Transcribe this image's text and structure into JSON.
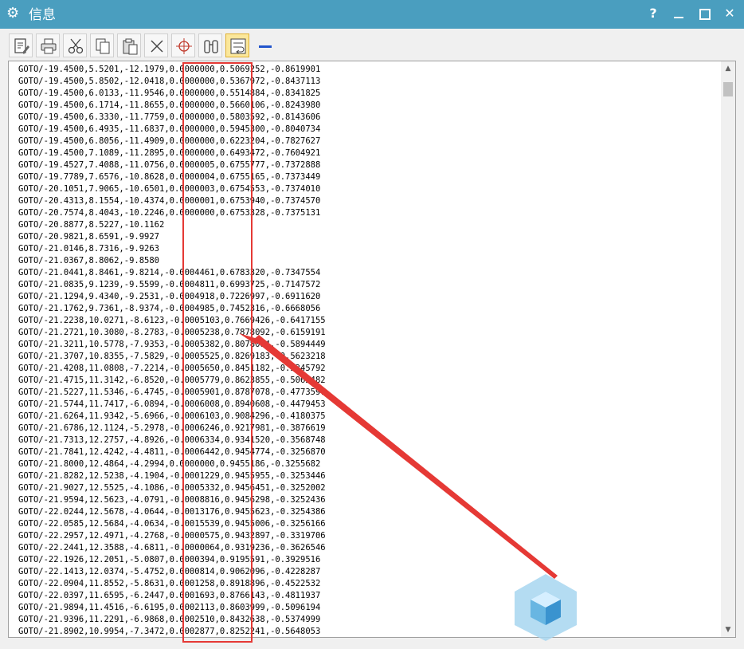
{
  "window": {
    "title": "信息",
    "help_label": "?"
  },
  "toolbar": {
    "buttons": [
      {
        "name": "edit-document-icon"
      },
      {
        "name": "print-icon"
      },
      {
        "name": "cut-icon"
      },
      {
        "name": "copy-icon"
      },
      {
        "name": "paste-icon"
      },
      {
        "name": "delete-icon"
      },
      {
        "name": "target-icon"
      },
      {
        "name": "binoculars-icon"
      },
      {
        "name": "word-wrap-icon"
      },
      {
        "name": "minus-icon"
      }
    ]
  },
  "lines": [
    "GOTO/-19.4500,5.5201,-12.1979,0.0000000,0.5069252,-0.8619901",
    "GOTO/-19.4500,5.8502,-12.0418,0.0000000,0.5367972,-0.8437113",
    "GOTO/-19.4500,6.0133,-11.9546,0.0000000,0.5514884,-0.8341825",
    "GOTO/-19.4500,6.1714,-11.8655,0.0000000,0.5660106,-0.8243980",
    "GOTO/-19.4500,6.3330,-11.7759,0.0000000,0.5803592,-0.8143606",
    "GOTO/-19.4500,6.4935,-11.6837,0.0000000,0.5945300,-0.8040734",
    "GOTO/-19.4500,6.8056,-11.4909,0.0000000,0.6223204,-0.7827627",
    "GOTO/-19.4500,7.1089,-11.2895,0.0000000,0.6493472,-0.7604921",
    "GOTO/-19.4527,7.4088,-11.0756,0.0000005,0.6755777,-0.7372888",
    "GOTO/-19.7789,7.6576,-10.8628,0.0000004,0.6755165,-0.7373449",
    "GOTO/-20.1051,7.9065,-10.6501,0.0000003,0.6754553,-0.7374010",
    "GOTO/-20.4313,8.1554,-10.4374,0.0000001,0.6753940,-0.7374570",
    "GOTO/-20.7574,8.4043,-10.2246,0.0000000,0.6753328,-0.7375131",
    "GOTO/-20.8877,8.5227,-10.1162",
    "GOTO/-20.9821,8.6591,-9.9927",
    "GOTO/-21.0146,8.7316,-9.9263",
    "GOTO/-21.0367,8.8062,-9.8580",
    "GOTO/-21.0441,8.8461,-9.8214,-0.0004461,0.6783320,-0.7347554",
    "GOTO/-21.0835,9.1239,-9.5599,-0.0004811,0.6993725,-0.7147572",
    "GOTO/-21.1294,9.4340,-9.2531,-0.0004918,0.7226997,-0.6911620",
    "GOTO/-21.1762,9.7361,-8.9374,-0.0004985,0.7452316,-0.6668056",
    "GOTO/-21.2238,10.0271,-8.6123,-0.0005103,0.7669426,-0.6417155",
    "GOTO/-21.2721,10.3080,-8.2783,-0.0005238,0.7878092,-0.6159191",
    "GOTO/-21.3211,10.5778,-7.9353,-0.0005382,0.8078084,-0.5894449",
    "GOTO/-21.3707,10.8355,-7.5829,-0.0005525,0.8269183,-0.5623218",
    "GOTO/-21.4208,11.0808,-7.2214,-0.0005650,0.8451182,-0.5345792",
    "GOTO/-21.4715,11.3142,-6.8520,-0.0005779,0.8623855,-0.5062482",
    "GOTO/-21.5227,11.5346,-6.4745,-0.0005901,0.8787078,-0.4773597",
    "GOTO/-21.5744,11.7417,-6.0894,-0.0006008,0.8940608,-0.4479453",
    "GOTO/-21.6264,11.9342,-5.6966,-0.0006103,0.9084296,-0.4180375",
    "GOTO/-21.6786,12.1124,-5.2978,-0.0006246,0.9217981,-0.3876619",
    "GOTO/-21.7313,12.2757,-4.8926,-0.0006334,0.9341520,-0.3568748",
    "GOTO/-21.7841,12.4242,-4.4811,-0.0006442,0.9454774,-0.3256870",
    "GOTO/-21.8000,12.4864,-4.2994,0.0000000,0.9455186,-0.3255682",
    "GOTO/-21.8282,12.5238,-4.1904,-0.0001229,0.9455955,-0.3253446",
    "GOTO/-21.9027,12.5525,-4.1086,-0.0005332,0.9456451,-0.3252002",
    "GOTO/-21.9594,12.5623,-4.0791,-0.0008816,0.9456298,-0.3252436",
    "GOTO/-22.0244,12.5678,-4.0644,-0.0013176,0.9455623,-0.3254386",
    "GOTO/-22.0585,12.5684,-4.0634,-0.0015539,0.9455006,-0.3256166",
    "GOTO/-22.2957,12.4971,-4.2768,-0.0000575,0.9432897,-0.3319706",
    "GOTO/-22.2441,12.3588,-4.6811,-0.0000064,0.9319236,-0.3626546",
    "GOTO/-22.1926,12.2051,-5.0807,0.0000394,0.9195591,-0.3929516",
    "GOTO/-22.1413,12.0374,-5.4752,0.0000814,0.9062096,-0.4228287",
    "GOTO/-22.0904,11.8552,-5.8631,0.0001258,0.8918896,-0.4522532",
    "GOTO/-22.0397,11.6595,-6.2447,0.0001693,0.8766143,-0.4811937",
    "GOTO/-21.9894,11.4516,-6.6195,0.0002113,0.8603999,-0.5096194",
    "GOTO/-21.9396,11.2291,-6.9868,0.0002510,0.8432638,-0.5374999",
    "GOTO/-21.8902,10.9954,-7.3472,0.0002877,0.8252241,-0.5648053"
  ]
}
